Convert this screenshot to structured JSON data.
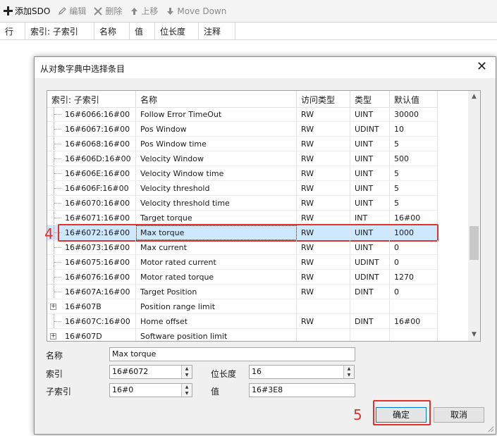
{
  "toolbar": {
    "add": {
      "label": "添加SDO",
      "icon": "plus-icon"
    },
    "edit": {
      "label": "编辑",
      "icon": "pencil-icon"
    },
    "delete": {
      "label": "删除",
      "icon": "x-icon"
    },
    "move_up": {
      "label": "上移",
      "icon": "arrow-up-icon"
    },
    "move_down": {
      "label": "Move Down",
      "icon": "arrow-down-icon"
    }
  },
  "background_table": {
    "columns": [
      "行",
      "索引: 子索引",
      "名称",
      "值",
      "位长度",
      "注释"
    ]
  },
  "dialog": {
    "title": "从对象字典中选择条目",
    "close_glyph": "✕",
    "tree": {
      "columns": [
        "索引: 子索引",
        "名称",
        "访问类型",
        "类型",
        "默认值"
      ],
      "rows": [
        {
          "index": "16#6066:16#00",
          "name": "Follow Error TimeOut",
          "access": "RW",
          "type": "UINT",
          "default": "30000"
        },
        {
          "index": "16#6067:16#00",
          "name": "Pos Window",
          "access": "RW",
          "type": "UDINT",
          "default": "10"
        },
        {
          "index": "16#6068:16#00",
          "name": "Pos Window time",
          "access": "RW",
          "type": "UINT",
          "default": "5"
        },
        {
          "index": "16#606D:16#00",
          "name": "Velocity Window",
          "access": "RW",
          "type": "UINT",
          "default": "500"
        },
        {
          "index": "16#606E:16#00",
          "name": "Velocity Window time",
          "access": "RW",
          "type": "UINT",
          "default": "5"
        },
        {
          "index": "16#606F:16#00",
          "name": "Velocity threshold",
          "access": "RW",
          "type": "UINT",
          "default": "5"
        },
        {
          "index": "16#6070:16#00",
          "name": "Velocity threshold time",
          "access": "RW",
          "type": "UINT",
          "default": "5"
        },
        {
          "index": "16#6071:16#00",
          "name": "Target torque",
          "access": "RW",
          "type": "INT",
          "default": "16#00"
        },
        {
          "index": "16#6072:16#00",
          "name": "Max torque",
          "access": "RW",
          "type": "UINT",
          "default": "1000",
          "selected": true
        },
        {
          "index": "16#6073:16#00",
          "name": "Max current",
          "access": "RW",
          "type": "UINT",
          "default": "0"
        },
        {
          "index": "16#6075:16#00",
          "name": "Motor rated current",
          "access": "RW",
          "type": "UDINT",
          "default": "0"
        },
        {
          "index": "16#6076:16#00",
          "name": "Motor rated torque",
          "access": "RW",
          "type": "UDINT",
          "default": "1270"
        },
        {
          "index": "16#607A:16#00",
          "name": "Target Position",
          "access": "RW",
          "type": "DINT",
          "default": "0"
        },
        {
          "index": "16#607B",
          "name": "Position range limit",
          "access": "",
          "type": "",
          "default": "",
          "expandable": true
        },
        {
          "index": "16#607C:16#00",
          "name": "Home offset",
          "access": "RW",
          "type": "DINT",
          "default": "16#00"
        },
        {
          "index": "16#607D",
          "name": "Software position limit",
          "access": "",
          "type": "",
          "default": "",
          "expandable": true
        }
      ]
    },
    "form": {
      "name_label": "名称",
      "name_value": "Max torque",
      "index_label": "索引",
      "index_value": "16#6072",
      "bitlength_label": "位长度",
      "bitlength_value": "16",
      "subindex_label": "子索引",
      "subindex_value": "16#0",
      "value_label": "值",
      "value_value": "16#3E8"
    },
    "ok_label": "确定",
    "cancel_label": "取消"
  },
  "annotations": {
    "step4": "4",
    "step5": "5"
  },
  "colors": {
    "selection": "#cde8ff",
    "annotation_red": "#e0312b",
    "accent": "#0078d7"
  }
}
